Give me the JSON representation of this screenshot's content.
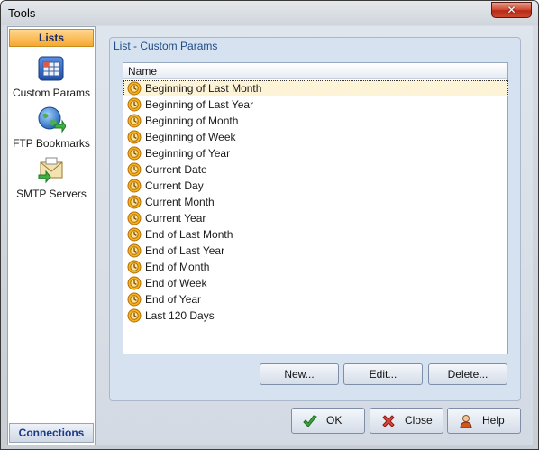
{
  "window": {
    "title": "Tools",
    "close_label": "✕"
  },
  "sidebar": {
    "header": "Lists",
    "footer": "Connections",
    "items": [
      {
        "label": "Custom Params",
        "icon": "custom-params-icon"
      },
      {
        "label": "FTP Bookmarks",
        "icon": "ftp-globe-icon"
      },
      {
        "label": "SMTP Servers",
        "icon": "smtp-envelope-icon"
      }
    ]
  },
  "main": {
    "group_title": "List - Custom Params",
    "column_header": "Name",
    "rows": [
      "Beginning of Last Month",
      "Beginning of Last Year",
      "Beginning of Month",
      "Beginning of Week",
      "Beginning of Year",
      "Current Date",
      "Current Day",
      "Current Month",
      "Current Year",
      "End of Last Month",
      "End of Last Year",
      "End of Month",
      "End of Week",
      "End of Year",
      "Last 120 Days"
    ],
    "selected_row": "Beginning of Last Month",
    "buttons": {
      "new": "New...",
      "edit": "Edit...",
      "delete": "Delete..."
    }
  },
  "footer_buttons": {
    "ok": "OK",
    "close": "Close",
    "help": "Help"
  },
  "colors": {
    "accent": "#f7a830",
    "selection": "#fdf3d6",
    "group_title": "#1f4c86"
  }
}
